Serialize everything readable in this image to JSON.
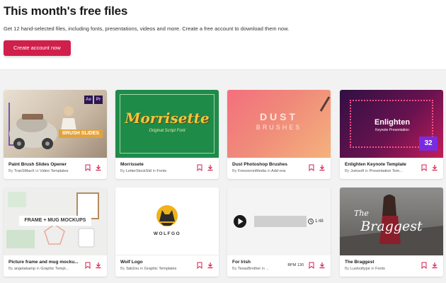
{
  "header": {
    "title": "This month's free files",
    "description": "Get 12 hand-selected files, including fonts, presentations, videos and more. Create a free account to download them now.",
    "cta_label": "Create account now"
  },
  "by_prefix": "By",
  "in_word": "in",
  "cards": [
    {
      "title": "Paint Brush Slides Opener",
      "author": "TranSMaxX",
      "category": "Video Templates",
      "thumb_text": "BRUSH SLIDES",
      "thumb_badges": [
        "Ae",
        "Pr"
      ]
    },
    {
      "title": "Morrissete",
      "author": "LetterStockStd",
      "category": "Fonts",
      "thumb_text": "Morrisette",
      "thumb_sub": "Original Script Font"
    },
    {
      "title": "Dust Photoshop Brushes",
      "author": "FreezeronMedia",
      "category": "Add-ons",
      "thumb_text": "DUST",
      "thumb_text2": "BRUSHES"
    },
    {
      "title": "Enlighten Keynote Template",
      "author": "Jumsoft",
      "category": "Presentation Tem...",
      "thumb_text": "Enlighten",
      "thumb_sub": "Keynote Presentation",
      "thumb_badge": "32"
    },
    {
      "title": "Picture frame and mug mocku...",
      "author": "angelakamp",
      "category": "Graphic Templ...",
      "thumb_text": "FRAME + MUG MOCKUPS"
    },
    {
      "title": "Wolf Logo",
      "author": "3ab2ou",
      "category": "Graphic Templates",
      "thumb_text": "WOLFGO"
    },
    {
      "title": "For Irish",
      "author": "TexasBrother",
      "category": "",
      "tail": "in ...",
      "duration": "1:48",
      "bpm": "BPM 130"
    },
    {
      "title": "The Braggest",
      "author": "Lustvoltype",
      "category": "Fonts",
      "thumb_text": "The",
      "thumb_text2": "Braggest"
    }
  ],
  "colors": {
    "accent": "#d11f4c",
    "background": "#f2f2f2"
  }
}
